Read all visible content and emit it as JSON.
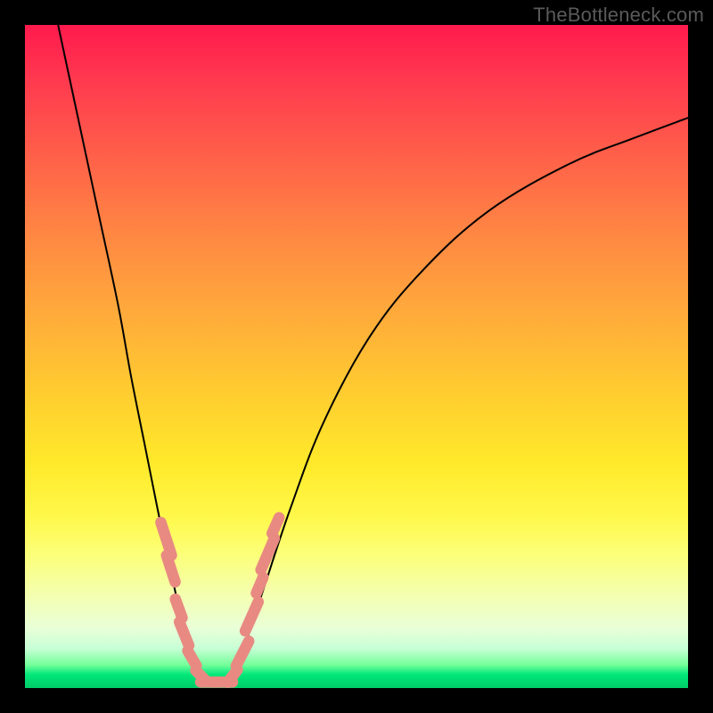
{
  "watermark": "TheBottleneck.com",
  "chart_data": {
    "type": "line",
    "title": "",
    "xlabel": "",
    "ylabel": "",
    "xlim": [
      0,
      100
    ],
    "ylim": [
      0,
      100
    ],
    "grid": false,
    "series": [
      {
        "name": "left-curve",
        "x": [
          5,
          8,
          11,
          14,
          16,
          18,
          20,
          21.5,
          23,
          24,
          25,
          26,
          27
        ],
        "y": [
          100,
          86,
          72,
          58,
          47,
          37,
          27,
          20,
          13,
          8,
          5,
          2.5,
          1
        ]
      },
      {
        "name": "right-curve",
        "x": [
          31,
          33,
          36,
          40,
          45,
          52,
          60,
          70,
          82,
          92,
          100
        ],
        "y": [
          1,
          6,
          15,
          27,
          40,
          53,
          63,
          72,
          79,
          83,
          86
        ]
      },
      {
        "name": "flat-minimum",
        "x": [
          27,
          31
        ],
        "y": [
          0.8,
          0.8
        ]
      }
    ],
    "markers": [
      {
        "name": "left-markers",
        "points": [
          {
            "x": 21.3,
            "y": 22.5,
            "len": 5.2,
            "angle": -72
          },
          {
            "x": 22.0,
            "y": 18.0,
            "len": 4.2,
            "angle": -72
          },
          {
            "x": 23.2,
            "y": 12.0,
            "len": 3.0,
            "angle": -70
          },
          {
            "x": 24.0,
            "y": 8.2,
            "len": 3.8,
            "angle": -68
          },
          {
            "x": 25.2,
            "y": 4.5,
            "len": 2.6,
            "angle": -60
          },
          {
            "x": 26.6,
            "y": 1.8,
            "len": 2.4,
            "angle": -45
          }
        ]
      },
      {
        "name": "right-markers",
        "points": [
          {
            "x": 31.3,
            "y": 1.8,
            "len": 2.4,
            "angle": 52
          },
          {
            "x": 32.8,
            "y": 5.2,
            "len": 4.2,
            "angle": 63
          },
          {
            "x": 34.2,
            "y": 10.8,
            "len": 4.8,
            "angle": 66
          },
          {
            "x": 35.4,
            "y": 15.5,
            "len": 2.6,
            "angle": 67
          },
          {
            "x": 36.6,
            "y": 20.2,
            "len": 5.2,
            "angle": 67
          },
          {
            "x": 37.8,
            "y": 24.5,
            "len": 2.6,
            "angle": 66
          }
        ]
      },
      {
        "name": "bottom-markers",
        "points": [
          {
            "x": 27.8,
            "y": 0.9,
            "len": 2.6,
            "angle": 0
          },
          {
            "x": 29.7,
            "y": 0.9,
            "len": 3.2,
            "angle": 0
          }
        ]
      }
    ],
    "marker_style": {
      "color": "#e88a82",
      "thickness_pct": 1.7,
      "cap": "round"
    },
    "curve_style": {
      "color": "#000000",
      "thickness_px": 2
    }
  }
}
